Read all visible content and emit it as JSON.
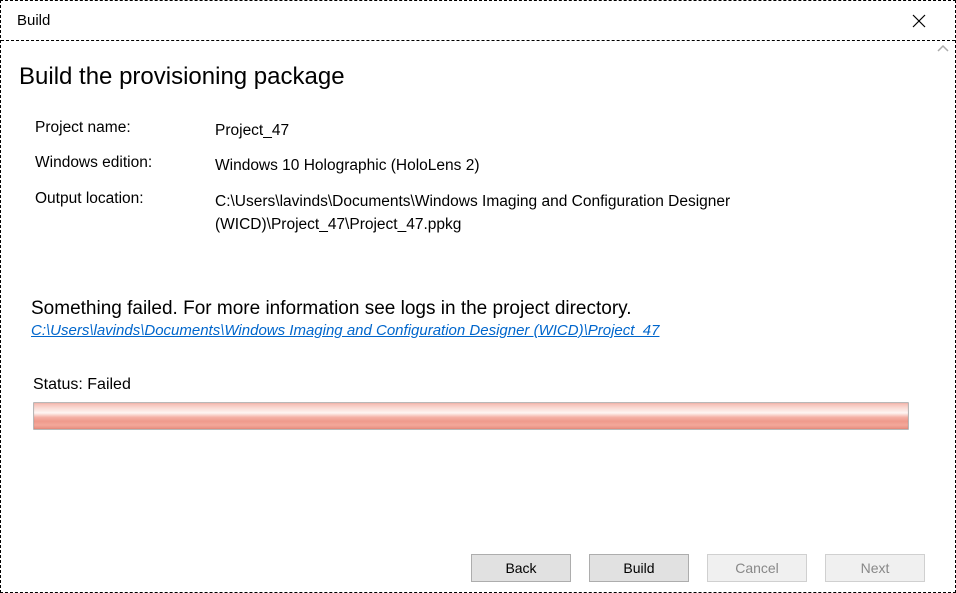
{
  "window": {
    "title": "Build"
  },
  "page": {
    "heading": "Build the provisioning package"
  },
  "details": {
    "project_name_label": "Project name:",
    "project_name_value": "Project_47",
    "windows_edition_label": "Windows edition:",
    "windows_edition_value": "Windows 10 Holographic (HoloLens 2)",
    "output_location_label": "Output location:",
    "output_location_value": "C:\\Users\\lavinds\\Documents\\Windows Imaging and Configuration Designer (WICD)\\Project_47\\Project_47.ppkg"
  },
  "error": {
    "message": "Something failed. For more information see logs in the project directory.",
    "link_text": "C:\\Users\\lavinds\\Documents\\Windows Imaging and Configuration Designer (WICD)\\Project_47"
  },
  "status": {
    "label": "Status:",
    "value": "Failed"
  },
  "buttons": {
    "back": "Back",
    "build": "Build",
    "cancel": "Cancel",
    "next": "Next"
  }
}
